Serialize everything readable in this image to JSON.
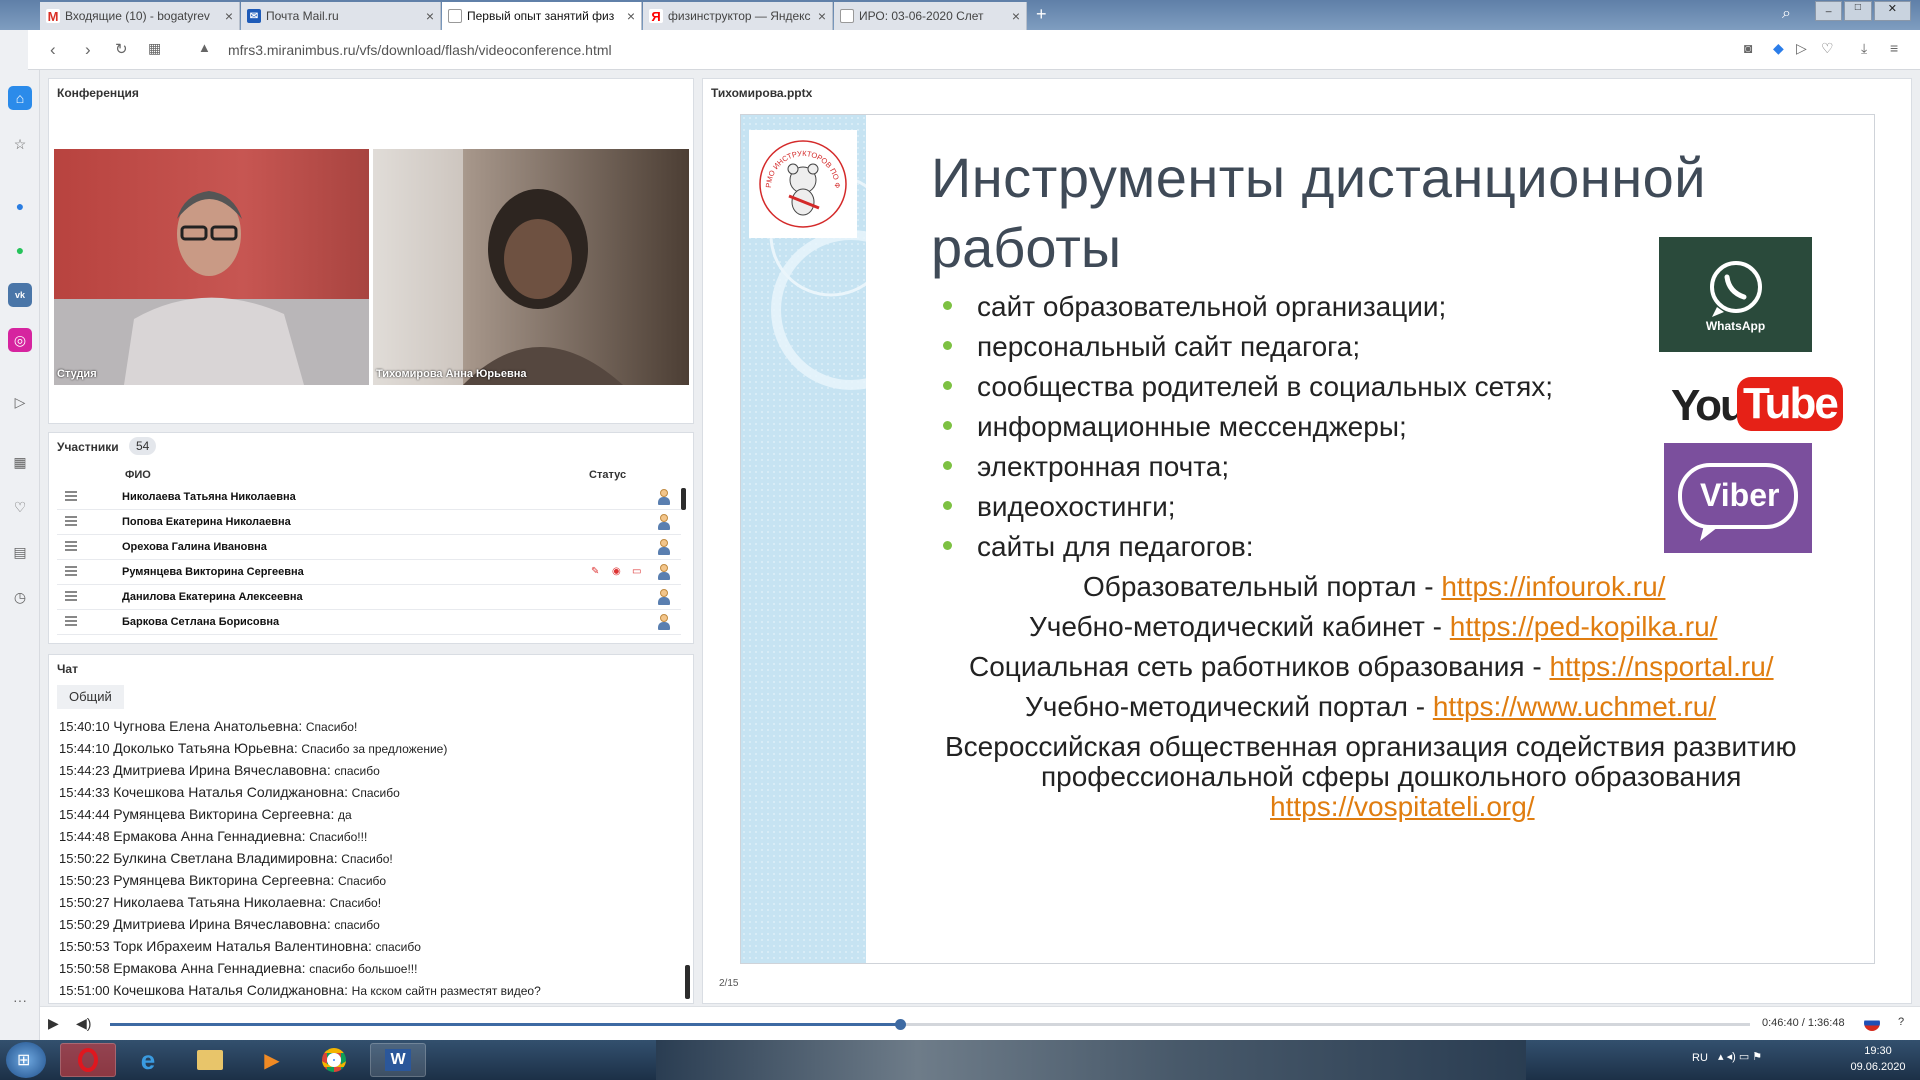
{
  "browser": {
    "tabs": [
      {
        "label": "Входящие (10) - bogatyrev",
        "icon": "gmail-icon"
      },
      {
        "label": "Почта Mail.ru",
        "icon": "mail-icon"
      },
      {
        "label": "Первый опыт занятий физ",
        "icon": "page-icon"
      },
      {
        "label": "физинструктор — Яндекс",
        "icon": "yandex-icon"
      },
      {
        "label": "ИРО: 03-06-2020 Слет",
        "icon": "page-icon"
      }
    ],
    "url": "mfrs3.miranimbus.ru/vfs/download/flash/videoconference.html"
  },
  "conference": {
    "title": "Конференция",
    "videos": [
      {
        "label": "Студия"
      },
      {
        "label": "Тихомирова Анна  Юрьевна"
      }
    ]
  },
  "participants": {
    "title": "Участники",
    "count": "54",
    "headers": {
      "name": "ФИО",
      "status": "Статус"
    },
    "rows": [
      {
        "name": "Николаева Татьяна  Николаевна"
      },
      {
        "name": "Попова  Екатерина Николаевна"
      },
      {
        "name": "Орехова  Галина  Ивановна"
      },
      {
        "name": "Румянцева Викторина  Сергеевна"
      },
      {
        "name": "Данилова  Екатерина  Алексеевна"
      },
      {
        "name": "Баркова Сетлана Борисовна"
      }
    ]
  },
  "chat": {
    "title": "Чат",
    "tab": "Общий",
    "messages": [
      {
        "time": "15:40:10",
        "name": "Чугнова   Елена    Анатольевна:",
        "text": "Спасибо!"
      },
      {
        "time": "15:44:10",
        "name": "Доколько   Татьяна    Юрьевна:",
        "text": "Спасибо за предложение)"
      },
      {
        "time": "15:44:23",
        "name": "Дмитриева   Ирина   Вячеславовна:",
        "text": "спасибо"
      },
      {
        "time": "15:44:33",
        "name": "Кочешкова   Наталья Солиджановна:",
        "text": "Спасибо"
      },
      {
        "time": "15:44:44",
        "name": "Румянцева Викторина   Сергеевна:",
        "text": "да"
      },
      {
        "time": "15:44:48",
        "name": "Ермакова   Анна   Геннадиевна:",
        "text": "Спасибо!!!"
      },
      {
        "time": "15:50:22",
        "name": "Булкина   Светлана Владимировна:",
        "text": "Спасибо!"
      },
      {
        "time": "15:50:23",
        "name": "Румянцева Викторина   Сергеевна:",
        "text": "Спасибо"
      },
      {
        "time": "15:50:27",
        "name": "Николаева Татьяна   Николаевна:",
        "text": "Спасибо!"
      },
      {
        "time": "15:50:29",
        "name": "Дмитриева   Ирина   Вячеславовна:",
        "text": "спасибо"
      },
      {
        "time": "15:50:53",
        "name": "Торк Ибрахеим   Наталья    Валентиновна:",
        "text": "спасибо"
      },
      {
        "time": "15:50:58",
        "name": "Ермакова   Анна   Геннадиевна:",
        "text": "спасибо большое!!!"
      },
      {
        "time": "15:51:00",
        "name": "Кочешкова   Наталья Солиджановна:",
        "text": "На кском сайтн разместят видео?"
      }
    ]
  },
  "presentation": {
    "filename": "Тихомирова.pptx",
    "page": "2/15",
    "slide": {
      "title_line1": "Инструменты дистанционной",
      "title_line2": "работы",
      "bullets": [
        "сайт образовательной организации;",
        "персональный сайт педагога;",
        "сообщества родителей в социальных сетях;",
        "информационные мессенджеры;",
        "электронная почта;",
        "видеохостинги;",
        "сайты для педагогов:"
      ],
      "links": [
        {
          "label": "Образовательный портал - ",
          "url": "https://infourok.ru/"
        },
        {
          "label": "Учебно-методический кабинет - ",
          "url": "https://ped-kopilka.ru/"
        },
        {
          "label": "Социальная сеть работников образования - ",
          "url": "https://nsportal.ru/"
        },
        {
          "label": "Учебно-методический портал - ",
          "url": "https://www.uchmet.ru/"
        }
      ],
      "final_line1": "Всероссийская общественная организация содействия развитию",
      "final_line2": "профессиональной сферы дошкольного образования",
      "final_url": "https://vospitateli.org/",
      "logos": {
        "whatsapp": "WhatsApp",
        "youtube_you": "You",
        "youtube_tube": "Tube",
        "viber": "Viber"
      },
      "badge_text": "РМО ИНСТРУКТОРОВ ПО ФИЗИЧЕСКОЙ КУЛЬТУРЕ ДОО ЯО"
    }
  },
  "media": {
    "time": "0:46:40 / 1:36:48",
    "progress": 0.482,
    "help": "?"
  },
  "taskbar": {
    "lang": "RU",
    "time": "19:30",
    "date": "09.06.2020"
  },
  "colors": {
    "accent": "#3d6aa3",
    "link": "#e07d10",
    "bullet": "#7dc142",
    "whatsapp_bg": "#2a4a3b",
    "viber_bg": "#7b4f9d",
    "youtube_red": "#e62117"
  }
}
